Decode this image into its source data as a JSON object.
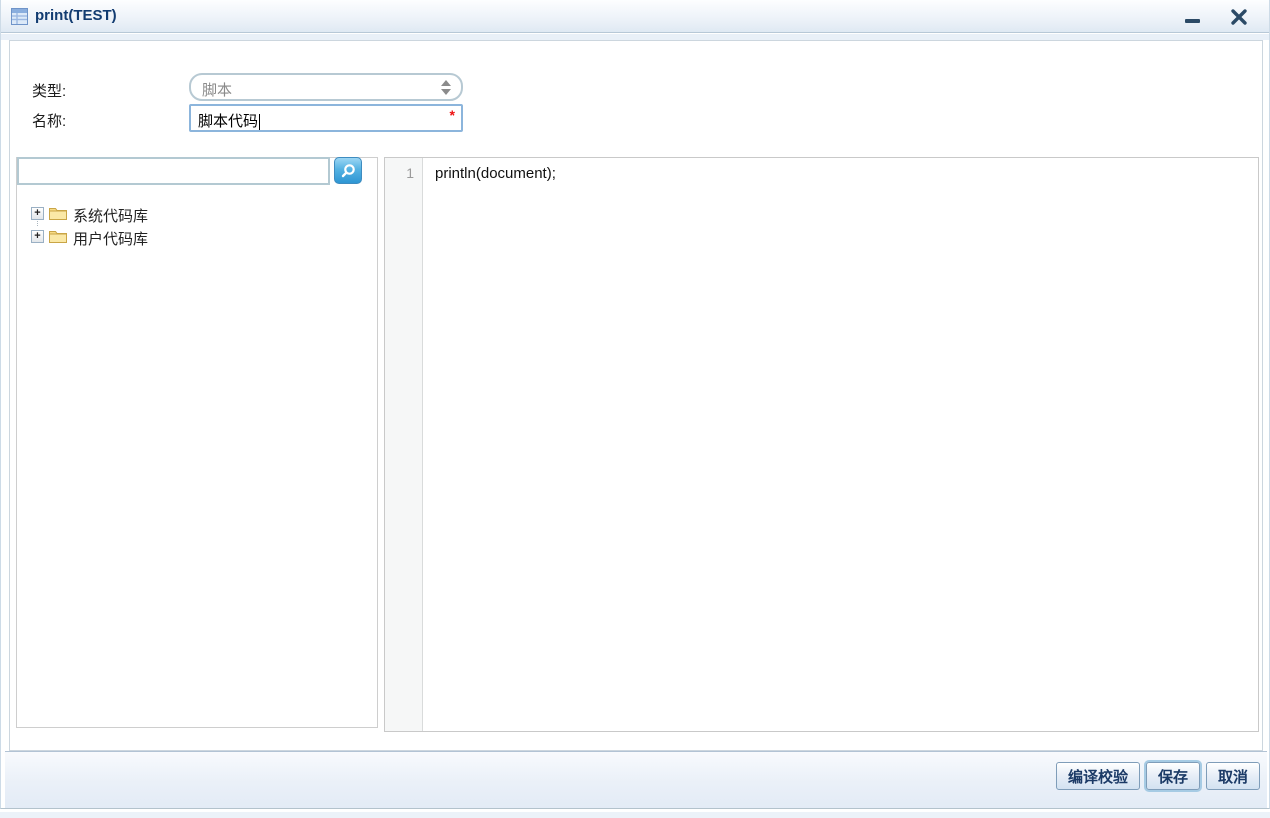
{
  "window": {
    "title": "print(TEST)"
  },
  "form": {
    "type": {
      "label": "类型:",
      "value": "脚本",
      "state": "disabled"
    },
    "name": {
      "label": "名称:",
      "value": "脚本代码",
      "required_marker": "*"
    }
  },
  "sidebar": {
    "search": {
      "placeholder": ""
    },
    "tree": [
      {
        "label": "系统代码库",
        "state": "collapsed"
      },
      {
        "label": "用户代码库",
        "state": "collapsed"
      }
    ]
  },
  "editor": {
    "lines": [
      {
        "number": "1",
        "code": "println(document);"
      }
    ]
  },
  "footer": {
    "buttons": [
      {
        "label": "编译校验"
      },
      {
        "label": "保存",
        "focused": true
      },
      {
        "label": "取消"
      }
    ]
  },
  "colors": {
    "accent_blue": "#2e96d4",
    "title_text": "#123c71",
    "button_text": "#1b3a66",
    "required_red": "#ee1111",
    "folder_yellow": "#f7db86",
    "footer_bg": "#e3ebf6"
  }
}
